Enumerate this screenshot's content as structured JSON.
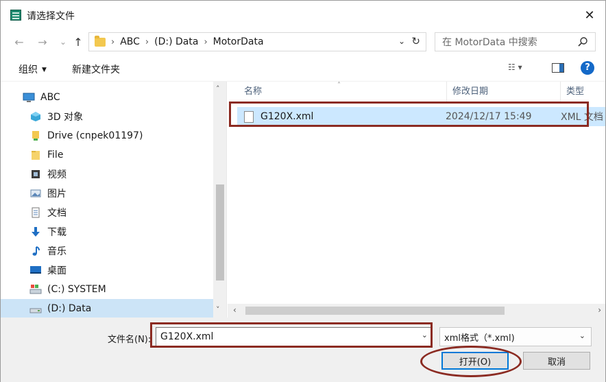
{
  "window": {
    "title": "请选择文件",
    "close_glyph": "✕"
  },
  "nav": {
    "back_glyph": "←",
    "forward_glyph": "→",
    "recent_glyph": "⌄",
    "up_glyph": "↑",
    "breadcrumbs": [
      "ABC",
      "(D:) Data",
      "MotorData"
    ],
    "sep_glyph": "›",
    "dropdown_glyph": "⌄",
    "refresh_glyph": "↻",
    "search_placeholder": "在 MotorData 中搜索"
  },
  "toolbar": {
    "organize_label": "组织",
    "organize_caret": "▼",
    "new_folder_label": "新建文件夹",
    "view_glyph": "☷ ▾",
    "help_glyph": "?"
  },
  "sidebar": {
    "items": [
      {
        "label": "ABC",
        "icon": "computer-icon"
      },
      {
        "label": "3D 对象",
        "icon": "3d-objects-icon"
      },
      {
        "label": "Drive (cnpek01197)",
        "icon": "drive-user-icon"
      },
      {
        "label": "File",
        "icon": "folder-icon"
      },
      {
        "label": "视频",
        "icon": "video-icon"
      },
      {
        "label": "图片",
        "icon": "picture-icon"
      },
      {
        "label": "文档",
        "icon": "document-icon"
      },
      {
        "label": "下载",
        "icon": "download-icon"
      },
      {
        "label": "音乐",
        "icon": "music-icon"
      },
      {
        "label": "桌面",
        "icon": "desktop-icon"
      },
      {
        "label": "(C:) SYSTEM",
        "icon": "system-drive-icon"
      },
      {
        "label": "(D:) Data",
        "icon": "data-drive-icon"
      }
    ],
    "scroll_up_glyph": "˄",
    "scroll_down_glyph": "˅"
  },
  "filelist": {
    "columns": {
      "name": "名称",
      "modified": "修改日期",
      "type": "类型"
    },
    "sort_glyph": "˄",
    "rows": [
      {
        "name": "G120X.xml",
        "modified": "2024/12/17 15:49",
        "type": "XML 文档"
      }
    ],
    "scroll_left_glyph": "‹",
    "scroll_right_glyph": "›"
  },
  "footer": {
    "filename_label": "文件名(N):",
    "filename_value": "G120X.xml",
    "filetype_value": "xml格式（*.xml)",
    "dropdown_glyph": "⌄",
    "open_label": "打开(O)",
    "cancel_label": "取消"
  },
  "colors": {
    "selection": "#cce8ff",
    "nav_selection": "#cce4f7",
    "annotation": "#8b2b22",
    "accent": "#0078d7"
  }
}
